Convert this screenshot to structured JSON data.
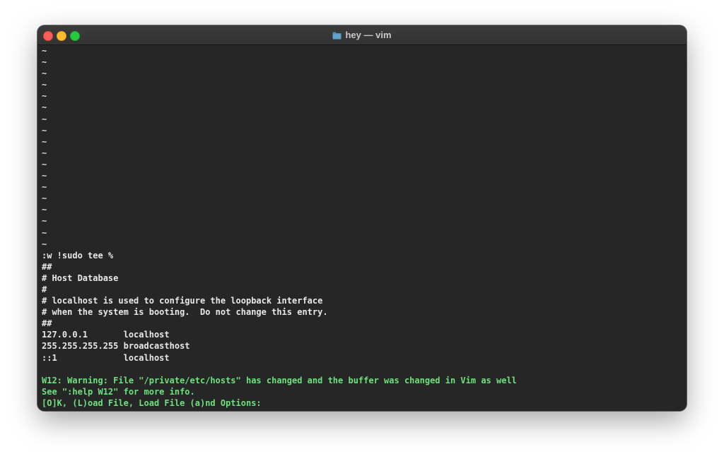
{
  "window": {
    "title": "hey — vim",
    "title_icon": "folder-icon",
    "colors": {
      "background": "#262626",
      "text": "#e8e8e8",
      "message": "#6fe07f",
      "close": "#ff5f57",
      "minimize": "#febc2e",
      "maximize": "#28c840"
    }
  },
  "terminal": {
    "tildes": [
      "~",
      "~",
      "~",
      "~",
      "~",
      "~",
      "~",
      "~",
      "~",
      "~",
      "~",
      "~",
      "~",
      "~",
      "~",
      "~",
      "~",
      "~"
    ],
    "command": ":w !sudo tee %",
    "output": [
      "##",
      "# Host Database",
      "#",
      "# localhost is used to configure the loopback interface",
      "# when the system is booting.  Do not change this entry.",
      "##",
      "127.0.0.1       localhost",
      "255.255.255.255 broadcasthost",
      "::1             localhost",
      ""
    ],
    "messages": [
      "W12: Warning: File \"/private/etc/hosts\" has changed and the buffer was changed in Vim as well",
      "See \":help W12\" for more info.",
      "[O]K, (L)oad File, Load File (a)nd Options:"
    ]
  }
}
